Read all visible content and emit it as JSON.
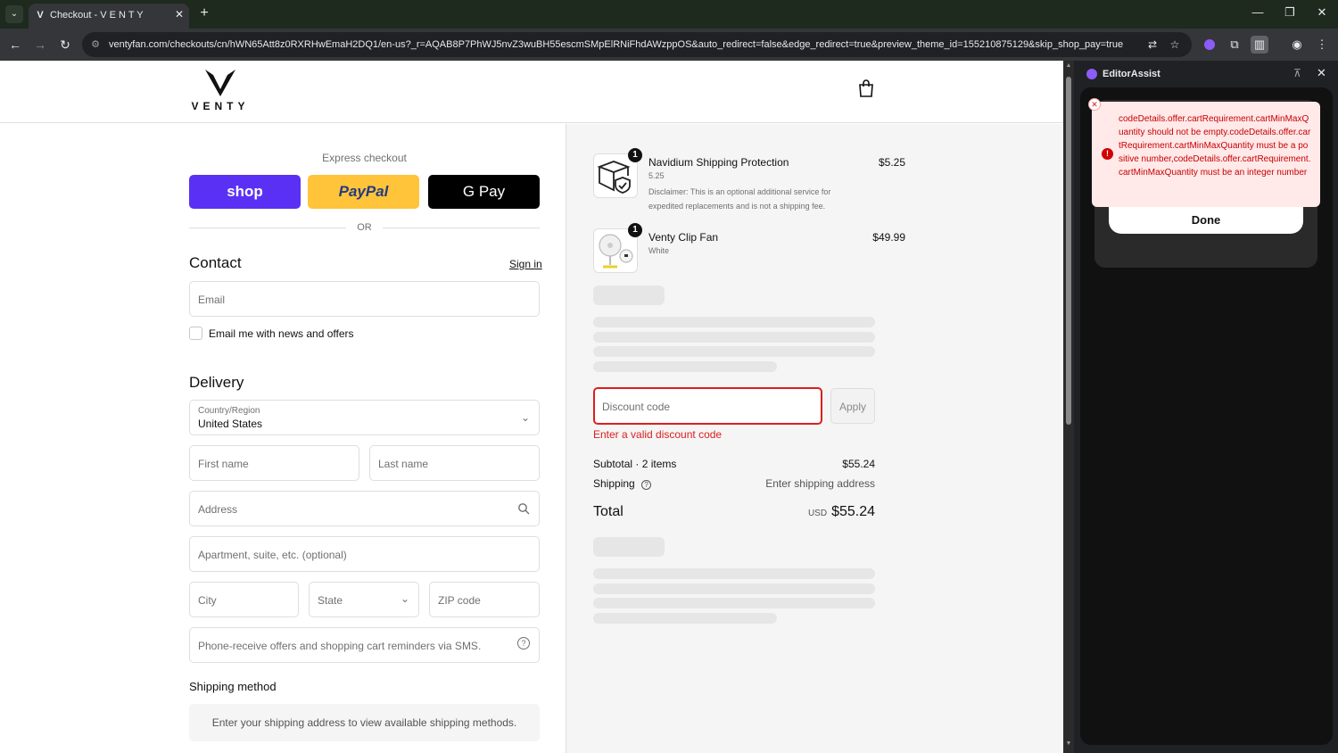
{
  "browser": {
    "tab_title": "Checkout - V E N T Y",
    "url": "ventyfan.com/checkouts/cn/hWN65Att8z0RXRHwEmaH2DQ1/en-us?_r=AQAB8P7PhWJ5nvZ3wuBH55escmSMpElRNiFhdAWzppOS&auto_redirect=false&edge_redirect=true&preview_theme_id=155210875129&skip_shop_pay=true"
  },
  "store": {
    "logo_text": "VENTY"
  },
  "express": {
    "title": "Express checkout",
    "shop_label": "shop",
    "paypal_label": "PayPal",
    "gpay_label": "G Pay",
    "or_label": "OR"
  },
  "contact": {
    "heading": "Contact",
    "sign_in": "Sign in",
    "email_placeholder": "Email",
    "news_label": "Email me with news and offers"
  },
  "delivery": {
    "heading": "Delivery",
    "country_label": "Country/Region",
    "country_value": "United States",
    "first_name": "First name",
    "last_name": "Last name",
    "address": "Address",
    "apartment": "Apartment, suite, etc. (optional)",
    "city": "City",
    "state": "State",
    "zip": "ZIP code",
    "phone": "Phone-receive offers and shopping cart reminders via SMS."
  },
  "shipping_method": {
    "heading": "Shipping method",
    "message": "Enter your shipping address to view available shipping methods."
  },
  "order": {
    "items": [
      {
        "name": "Navidium Shipping Protection",
        "variant": "5.25",
        "description": "Disclaimer: This is an optional additional service for expedited replacements and is not a shipping fee.",
        "price": "$5.25",
        "qty": "1"
      },
      {
        "name": "Venty Clip Fan",
        "variant": "White",
        "price": "$49.99",
        "qty": "1"
      }
    ],
    "discount_placeholder": "Discount code",
    "apply_label": "Apply",
    "discount_error": "Enter a valid discount code",
    "subtotal_label": "Subtotal · 2 items",
    "subtotal_value": "$55.24",
    "shipping_label": "Shipping",
    "shipping_value": "Enter shipping address",
    "total_label": "Total",
    "currency": "USD",
    "total_value": "$55.24"
  },
  "side_panel": {
    "title": "EditorAssist",
    "error_message": "codeDetails.offer.cartRequirement.cartMinMaxQuantity should not be empty.codeDetails.offer.cartRequirement.cartMinMaxQuantity must be a positive number,codeDetails.offer.cartRequirement.cartMinMaxQuantity must be an integer number",
    "done_label": "Done"
  },
  "colors": {
    "accent_error": "#dd1d1d",
    "shop_purple": "#5a31f4",
    "paypal_yellow": "#ffc439"
  }
}
